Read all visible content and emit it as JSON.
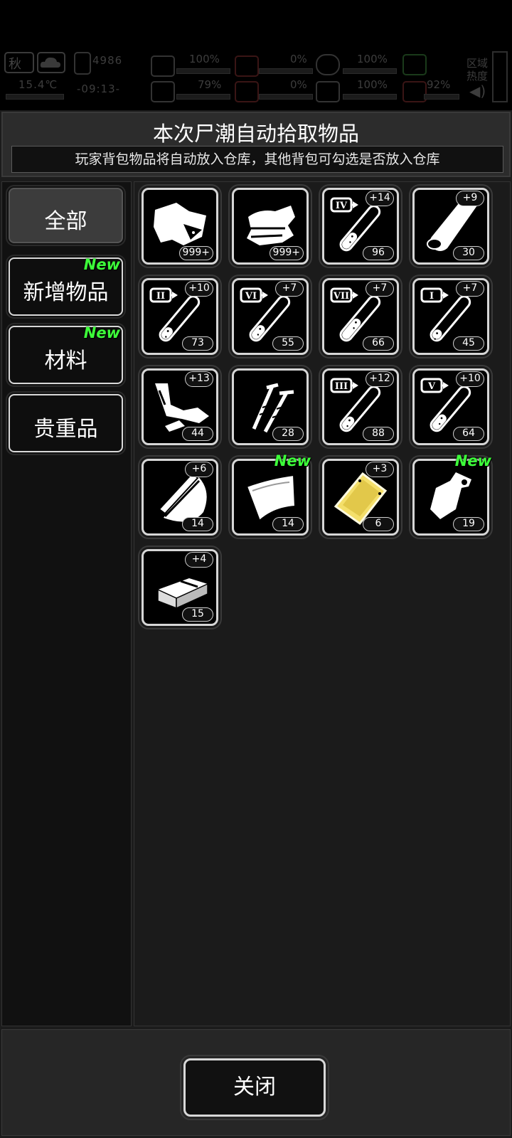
{
  "hud": {
    "season": "秋",
    "temperature": "15.4℃",
    "day_counter": "4986",
    "clock": "-09:13-",
    "stats": [
      {
        "name": "health",
        "value": "100%"
      },
      {
        "name": "hunger",
        "value": "0%"
      },
      {
        "name": "stamina",
        "value": "100%"
      },
      {
        "name": "sanity",
        "value": "79%"
      },
      {
        "name": "bleeding",
        "value": "0%"
      },
      {
        "name": "heart",
        "value": "100%"
      },
      {
        "name": "water",
        "value": "92%"
      }
    ],
    "region_label_1": "区域",
    "region_label_2": "热度"
  },
  "dialog": {
    "title": "本次尸潮自动拾取物品",
    "subtitle": "玩家背包物品将自动放入仓库，其他背包可勾选是否放入仓库",
    "close_label": "关闭"
  },
  "categories": [
    {
      "label": "全部",
      "new": ""
    },
    {
      "label": "新增物品",
      "new": "New"
    },
    {
      "label": "材料",
      "new": "New"
    },
    {
      "label": "贵重品",
      "new": ""
    }
  ],
  "items": [
    {
      "icon": "cloth-scrap-icon",
      "qty": "999+",
      "added": "",
      "new": ""
    },
    {
      "icon": "folded-cloth-icon",
      "qty": "999+",
      "added": "",
      "new": ""
    },
    {
      "icon": "test-tube-icon",
      "tier": "IV",
      "qty": "96",
      "added": "+14",
      "new": "",
      "fill": 0.55
    },
    {
      "icon": "wood-log-icon",
      "qty": "30",
      "added": "+9",
      "new": ""
    },
    {
      "icon": "test-tube-icon",
      "tier": "II",
      "qty": "73",
      "added": "+10",
      "new": "",
      "fill": 0.35
    },
    {
      "icon": "test-tube-icon",
      "tier": "VI",
      "qty": "55",
      "added": "+7",
      "new": "",
      "fill": 0.45
    },
    {
      "icon": "test-tube-icon",
      "tier": "VII",
      "qty": "66",
      "added": "+7",
      "new": "",
      "fill": 0.75
    },
    {
      "icon": "test-tube-icon",
      "tier": "I",
      "qty": "45",
      "added": "+7",
      "new": "",
      "fill": 0.25
    },
    {
      "icon": "scrap-metal-icon",
      "qty": "44",
      "added": "+13",
      "new": ""
    },
    {
      "icon": "nails-icon",
      "qty": "28",
      "added": "",
      "new": ""
    },
    {
      "icon": "test-tube-icon",
      "tier": "III",
      "qty": "88",
      "added": "+12",
      "new": "",
      "fill": 0.4
    },
    {
      "icon": "test-tube-icon",
      "tier": "V",
      "qty": "64",
      "added": "+10",
      "new": "",
      "fill": 0.5
    },
    {
      "icon": "wood-planks-icon",
      "qty": "14",
      "added": "+6",
      "new": ""
    },
    {
      "icon": "bandage-sheet-icon",
      "qty": "14",
      "added": "",
      "new": "New"
    },
    {
      "icon": "gold-plate-icon",
      "qty": "6",
      "added": "+3",
      "new": ""
    },
    {
      "icon": "plastic-bag-icon",
      "qty": "19",
      "added": "",
      "new": "New"
    },
    {
      "icon": "brick-icon",
      "qty": "15",
      "added": "+4",
      "new": ""
    }
  ]
}
